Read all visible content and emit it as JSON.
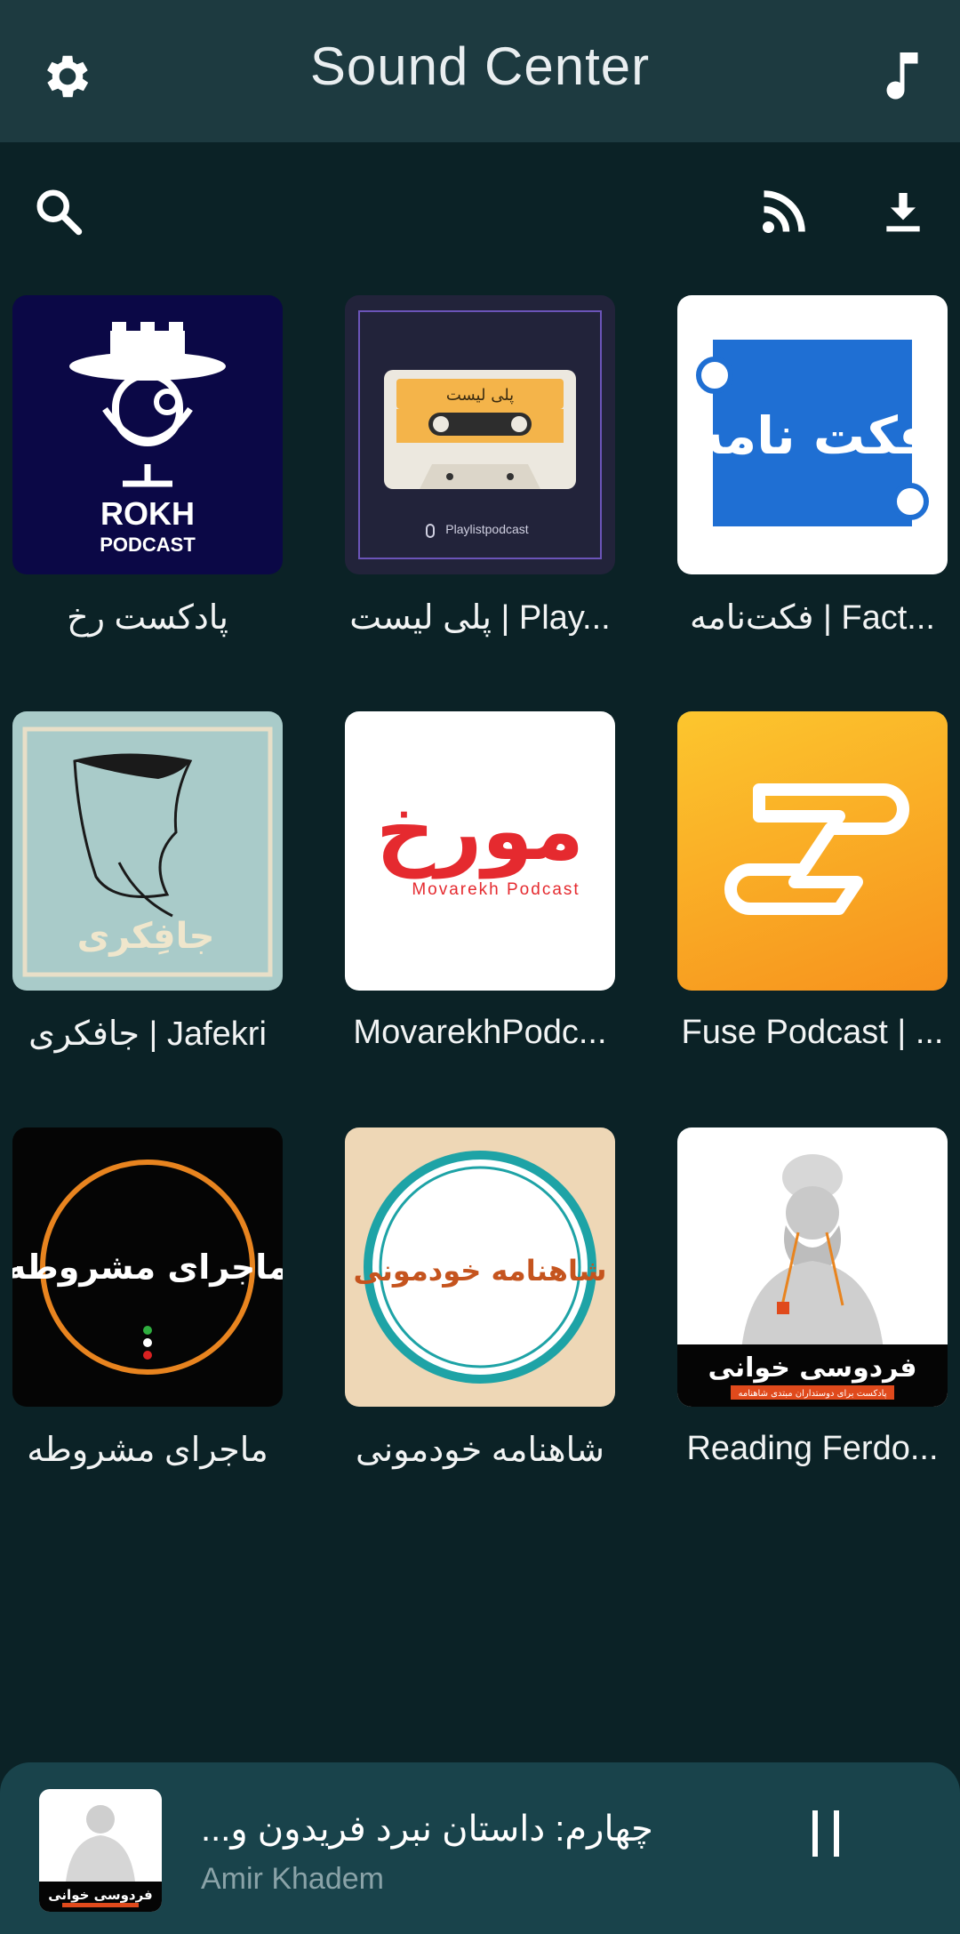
{
  "app": {
    "title": "Sound Center"
  },
  "header": {
    "settings_icon": "gear-icon",
    "music_icon": "music-note-icon"
  },
  "toolbar": {
    "search_icon": "search-icon",
    "rss_icon": "rss-icon",
    "download_icon": "download-icon"
  },
  "podcasts": [
    {
      "title": "پادکست رخ",
      "cover": {
        "logo_text": "ROKH",
        "sub_text": "PODCAST",
        "bg": "#0b0846"
      }
    },
    {
      "title": "پلی لیست | Play...",
      "cover": {
        "tape_label": "پلی لیست",
        "caption": "Playlistpodcast",
        "bg": "#22233a"
      }
    },
    {
      "title": "فکت‌نامه | Fact...",
      "cover": {
        "logo_text": "فکت نامه",
        "bg": "#ffffff",
        "accent": "#1f6fd3"
      }
    },
    {
      "title": "جافکری | Jafekri",
      "cover": {
        "logo_text": "جافِکری",
        "bg": "#a9cbc9"
      }
    },
    {
      "title": "MovarekhPodc...",
      "cover": {
        "logo_text": "مورخ",
        "caption": "Movarekh Podcast",
        "bg": "#ffffff",
        "accent": "#e52a2f"
      }
    },
    {
      "title": "Fuse Podcast | ...",
      "cover": {
        "logo_text": "",
        "bg": "#f7a325"
      }
    },
    {
      "title": "ماجرای مشروطه",
      "cover": {
        "logo_text": "ماجرای مشروطه",
        "bg": "#050505",
        "accent": "#e8841f"
      }
    },
    {
      "title": "شاهنامه خودمونی",
      "cover": {
        "logo_text": "شاهنامه خودمونی",
        "bg": "#eed7b6",
        "accent": "#1ea3a6"
      }
    },
    {
      "title": "Reading Ferdo...",
      "cover": {
        "logo_text": "فردوسی خوانی",
        "caption": "پادکست برای دوستداران مبتدی شاهنامه",
        "bg": "#ffffff"
      }
    }
  ],
  "player": {
    "track": "...چهارم: داستان نبرد فریدون و",
    "artist": "Amir Khadem",
    "thumb_text": "فردوسی خوانی",
    "pause_icon": "pause-icon"
  }
}
